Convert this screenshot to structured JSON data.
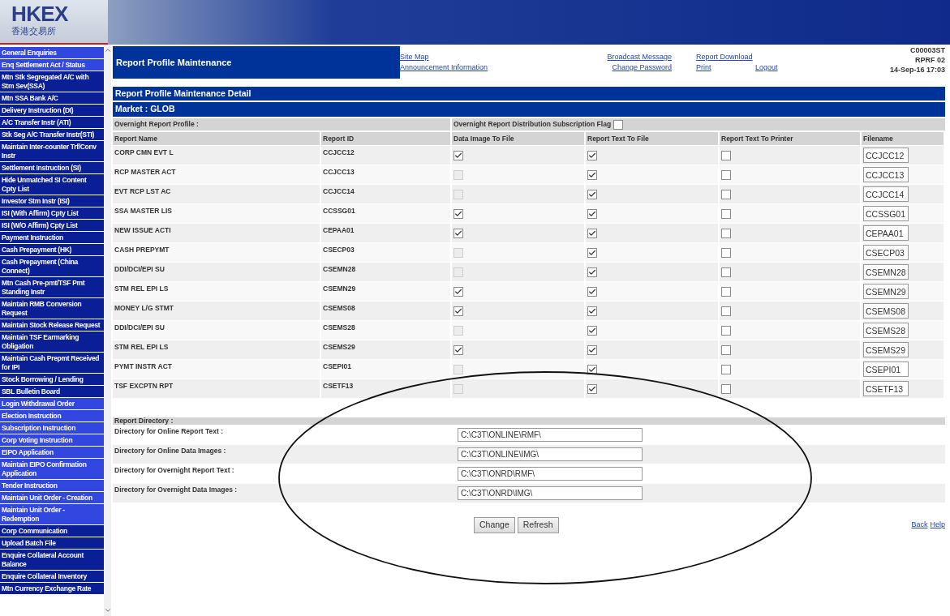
{
  "logo": {
    "text": "HKEX",
    "subtext": "香港交易所"
  },
  "sidebar": {
    "items": [
      {
        "label": "General Enquiries",
        "color": "#3246e0"
      },
      {
        "label": "Enq Settlement Act / Status",
        "color": "#3246e0"
      },
      {
        "label": "Mtn Stk Segregated A/C with Stm Sev(SSA)",
        "color": "#0a1f96"
      },
      {
        "label": "Mtn SSA Bank A/C",
        "color": "#0a1f96"
      },
      {
        "label": "Delivery Instruction (DI)",
        "color": "#0a1f96"
      },
      {
        "label": "A/C Transfer Instr (ATI)",
        "color": "#0a1f96"
      },
      {
        "label": "Stk Seg A/C Transfer Instr(STI)",
        "color": "#0a1f96"
      },
      {
        "label": "Maintain Inter-counter Trf/Conv Instr",
        "color": "#0a1f96"
      },
      {
        "label": "Settlement Instruction (SI)",
        "color": "#0a1f96"
      },
      {
        "label": "Hide Unmatched SI Content Cpty List",
        "color": "#0a1f96"
      },
      {
        "label": "Investor Stm Instr (ISI)",
        "color": "#0a1f96"
      },
      {
        "label": "ISI (With Affirm) Cpty List",
        "color": "#0a1f96"
      },
      {
        "label": "ISI (W/O Affirm) Cpty List",
        "color": "#0a1f96"
      },
      {
        "label": "Payment Instruction",
        "color": "#0a1f96"
      },
      {
        "label": "Cash Prepayment (HK)",
        "color": "#0a1f96"
      },
      {
        "label": "Cash Prepayment (China Connect)",
        "color": "#0a1f96"
      },
      {
        "label": "Mtn Cash Pre-pmt/TSF Pmt Standing Instr",
        "color": "#0a1f96"
      },
      {
        "label": "Maintain RMB Conversion Request",
        "color": "#0a1f96"
      },
      {
        "label": "Maintain Stock Release Request",
        "color": "#0a1f96"
      },
      {
        "label": "Maintain TSF Earmarking Obligation",
        "color": "#0a1f96"
      },
      {
        "label": "Maintain Cash Prepmt Received for IPI",
        "color": "#0a1f96"
      },
      {
        "label": "Stock Borrowing / Lending",
        "color": "#0a1f96"
      },
      {
        "label": "SBL Bulletin Board",
        "color": "#0a1f96"
      },
      {
        "label": "Login Withdrawal Order",
        "color": "#3246e0"
      },
      {
        "label": "Election Instruction",
        "color": "#3246e0"
      },
      {
        "label": "Subscription Instruction",
        "color": "#3246e0"
      },
      {
        "label": "Corp Voting Instruction",
        "color": "#3246e0"
      },
      {
        "label": "EIPO Application",
        "color": "#3246e0"
      },
      {
        "label": "Maintain EIPO Confirmation Application",
        "color": "#3246e0"
      },
      {
        "label": "Tender Instruction",
        "color": "#3246e0"
      },
      {
        "label": "Maintain Unit Order - Creation",
        "color": "#3246e0"
      },
      {
        "label": "Maintain Unit Order - Redemption",
        "color": "#3246e0"
      },
      {
        "label": "Corp Communication",
        "color": "#0a1f96"
      },
      {
        "label": "Upload Batch File",
        "color": "#0a1f96"
      },
      {
        "label": "Enquire Collateral Account Balance",
        "color": "#0a1f96"
      },
      {
        "label": "Enquire Collateral Inventory",
        "color": "#0a1f96"
      },
      {
        "label": "Mtn Currency Exchange Rate",
        "color": "#0a1f96"
      }
    ]
  },
  "header": {
    "title": "Report Profile Maintenance",
    "links": [
      [
        "Site Map",
        "Broadcast Message",
        "Report Download"
      ],
      [
        "Announcement Information",
        "Change Password",
        "Print",
        "Logout"
      ]
    ],
    "codes": [
      "C00003ST",
      "RPRF 02",
      "14-Sep-16 17:03"
    ]
  },
  "detail": {
    "title": "Report Profile Maintenance Detail",
    "market": "Market : GLOB",
    "profile_label": "Overnight Report Profile :",
    "flag": {
      "label": "Overnight Report Distribution Subscription Flag",
      "checked": false
    },
    "columns": [
      "Report Name",
      "Report ID",
      "Data Image To File",
      "Report Text To File",
      "Report Text To Printer",
      "Filename"
    ],
    "rows": [
      {
        "name": "CORP CMN EVT L",
        "id": "CCJCC12",
        "data_image": {
          "checked": true,
          "disabled": false
        },
        "text_file": {
          "checked": true,
          "disabled": false
        },
        "printer": {
          "checked": false,
          "disabled": false
        },
        "filename": "CCJCC12"
      },
      {
        "name": "RCP MASTER ACT",
        "id": "CCJCC13",
        "data_image": {
          "checked": false,
          "disabled": true
        },
        "text_file": {
          "checked": true,
          "disabled": false
        },
        "printer": {
          "checked": false,
          "disabled": false
        },
        "filename": "CCJCC13"
      },
      {
        "name": "EVT RCP LST AC",
        "id": "CCJCC14",
        "data_image": {
          "checked": false,
          "disabled": true
        },
        "text_file": {
          "checked": true,
          "disabled": false
        },
        "printer": {
          "checked": false,
          "disabled": false
        },
        "filename": "CCJCC14"
      },
      {
        "name": "SSA MASTER LIS",
        "id": "CCSSG01",
        "data_image": {
          "checked": true,
          "disabled": false
        },
        "text_file": {
          "checked": true,
          "disabled": false
        },
        "printer": {
          "checked": false,
          "disabled": false
        },
        "filename": "CCSSG01"
      },
      {
        "name": "NEW ISSUE ACTI",
        "id": "CEPAA01",
        "data_image": {
          "checked": true,
          "disabled": false
        },
        "text_file": {
          "checked": true,
          "disabled": false
        },
        "printer": {
          "checked": false,
          "disabled": false
        },
        "filename": "CEPAA01"
      },
      {
        "name": "CASH PREPYMT",
        "id": "CSECP03",
        "data_image": {
          "checked": false,
          "disabled": true
        },
        "text_file": {
          "checked": true,
          "disabled": false
        },
        "printer": {
          "checked": false,
          "disabled": false
        },
        "filename": "CSECP03"
      },
      {
        "name": "DDI/DCI/EPI SU",
        "id": "CSEMN28",
        "data_image": {
          "checked": false,
          "disabled": true
        },
        "text_file": {
          "checked": true,
          "disabled": false
        },
        "printer": {
          "checked": false,
          "disabled": false
        },
        "filename": "CSEMN28"
      },
      {
        "name": "STM REL EPI LS",
        "id": "CSEMN29",
        "data_image": {
          "checked": true,
          "disabled": false
        },
        "text_file": {
          "checked": true,
          "disabled": false
        },
        "printer": {
          "checked": false,
          "disabled": false
        },
        "filename": "CSEMN29"
      },
      {
        "name": "MONEY L/G STMT",
        "id": "CSEMS08",
        "data_image": {
          "checked": true,
          "disabled": false
        },
        "text_file": {
          "checked": true,
          "disabled": false
        },
        "printer": {
          "checked": false,
          "disabled": false
        },
        "filename": "CSEMS08"
      },
      {
        "name": "DDI/DCI/EPI SU",
        "id": "CSEMS28",
        "data_image": {
          "checked": false,
          "disabled": true
        },
        "text_file": {
          "checked": true,
          "disabled": false
        },
        "printer": {
          "checked": false,
          "disabled": false
        },
        "filename": "CSEMS28"
      },
      {
        "name": "STM REL EPI LS",
        "id": "CSEMS29",
        "data_image": {
          "checked": true,
          "disabled": false
        },
        "text_file": {
          "checked": true,
          "disabled": false
        },
        "printer": {
          "checked": false,
          "disabled": false
        },
        "filename": "CSEMS29"
      },
      {
        "name": "PYMT INSTR ACT",
        "id": "CSEPI01",
        "data_image": {
          "checked": false,
          "disabled": true
        },
        "text_file": {
          "checked": true,
          "disabled": false
        },
        "printer": {
          "checked": false,
          "disabled": false
        },
        "filename": "CSEPI01"
      },
      {
        "name": "TSF EXCPTN RPT",
        "id": "CSETF13",
        "data_image": {
          "checked": false,
          "disabled": true
        },
        "text_file": {
          "checked": true,
          "disabled": false
        },
        "printer": {
          "checked": false,
          "disabled": false
        },
        "filename": "CSETF13"
      }
    ]
  },
  "directory": {
    "title": "Report Directory :",
    "fields": [
      {
        "label": "Directory for Online Report Text :",
        "value": "C:\\C3T\\ONLINE\\RMF\\"
      },
      {
        "label": "Directory for Online Data Images :",
        "value": "C:\\C3T\\ONLINE\\IMG\\"
      },
      {
        "label": "Directory for Overnight Report Text :",
        "value": "C:\\C3T\\ONRD\\RMF\\"
      },
      {
        "label": "Directory for Overnight Data Images :",
        "value": "C:\\C3T\\ONRD\\IMG\\"
      }
    ]
  },
  "buttons": [
    "Change",
    "Refresh"
  ],
  "footer_links": [
    "Back",
    "Help"
  ]
}
